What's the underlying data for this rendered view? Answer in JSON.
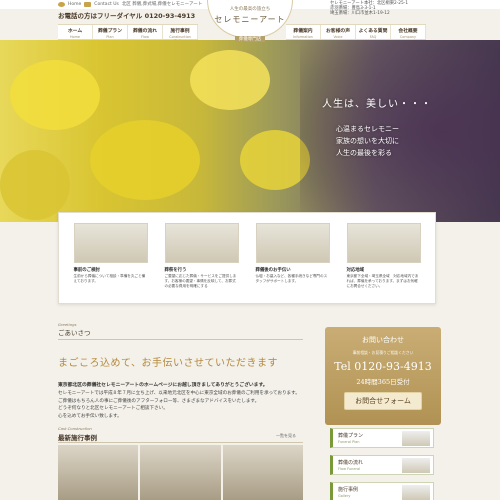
{
  "topbar": {
    "home": "Home",
    "contact": "Contact Us",
    "areas": "北区 葬儀,葬式場,葬儀セレモニーアート"
  },
  "header": {
    "tel_label": "お電話の方はフリーダイヤル",
    "tel_number": "0120-93-4913",
    "branches": [
      "セレモニーアート本社：北区桐東2-25-1",
      "赤羽斎場：豊島3-3-1-1",
      "埼玉斎場：川口市並木1-19-12"
    ]
  },
  "logo": {
    "line1": "人生の最高の旅立ち",
    "line2": "セレモニーアート",
    "line3": "葬儀専門店"
  },
  "nav_left": [
    {
      "jp": "ホーム",
      "en": "Home"
    },
    {
      "jp": "葬儀プラン",
      "en": "Plan"
    },
    {
      "jp": "葬儀の流れ",
      "en": "Flow"
    },
    {
      "jp": "施行事例",
      "en": "Construction Gallery"
    }
  ],
  "nav_right": [
    {
      "jp": "葬儀案内",
      "en": "Information"
    },
    {
      "jp": "お客様の声",
      "en": "Voice"
    },
    {
      "jp": "よくある質問",
      "en": "FAQ"
    },
    {
      "jp": "会社概要",
      "en": "Company"
    }
  ],
  "hero": {
    "title": "人生は、美しい・・・",
    "lines": [
      "心温まるセレモニー",
      "家族の想いを大切に",
      "人生の最後を彩る"
    ]
  },
  "features": [
    {
      "title": "事前のご検討",
      "text": "生前から葬儀について相談・準備を丸ごと備えております。"
    },
    {
      "title": "葬祭を行う",
      "text": "ご要望に応じた葬儀・サービスをご提供します。お客様の要望・事情を反映して、お葬式の必要な費用を明確にする"
    },
    {
      "title": "葬儀後のお手伝い",
      "text": "仏壇・お墓入など、各種手続きなど専門のスタッフがサポートします。"
    },
    {
      "title": "対応地域",
      "text": "東京都下全域・埼玉県全域　対応地域内であれば、葬儀を承っております。まずはお気軽にお問合せください。"
    }
  ],
  "greeting": {
    "en": "Greetings",
    "jp": "ごあいさつ",
    "lead": "まごころ込めて、お手伝いさせていただきます",
    "bold": "東京都北区の葬儀社セレモニーアートのホームページにお越し頂きましてありがとうございます。",
    "paragraph": [
      "セレモニーアートでは平成８年７月に立ち上げ、以来地元北区を中心に東京全域のお葬儀のご利用を承っております。",
      "ご葬儀はもちろん人の事にご葬儀後のアフターフォロー等、さまざまなアドバイスをいたします。",
      "どうぞ何なりと北区セレモニーアートご相談下さい。",
      "心を込めてお手伝い致します。"
    ]
  },
  "works": {
    "en": "Cast Construction",
    "jp": "最新施行事例",
    "more": "一覧を見る"
  },
  "contact": {
    "title": "お問い合わせ",
    "sub": "事前相談・お見積りご相談ください",
    "tel": "Tel 0120-93-4913",
    "hours": "24時間365日受付",
    "button": "お問合せフォーム"
  },
  "side_buttons": [
    {
      "jp": "葬儀プラン",
      "en": "Funeral Plan"
    },
    {
      "jp": "葬儀の流れ",
      "en": "Flow Funeral"
    },
    {
      "jp": "施行事例",
      "en": "Gallery"
    }
  ]
}
